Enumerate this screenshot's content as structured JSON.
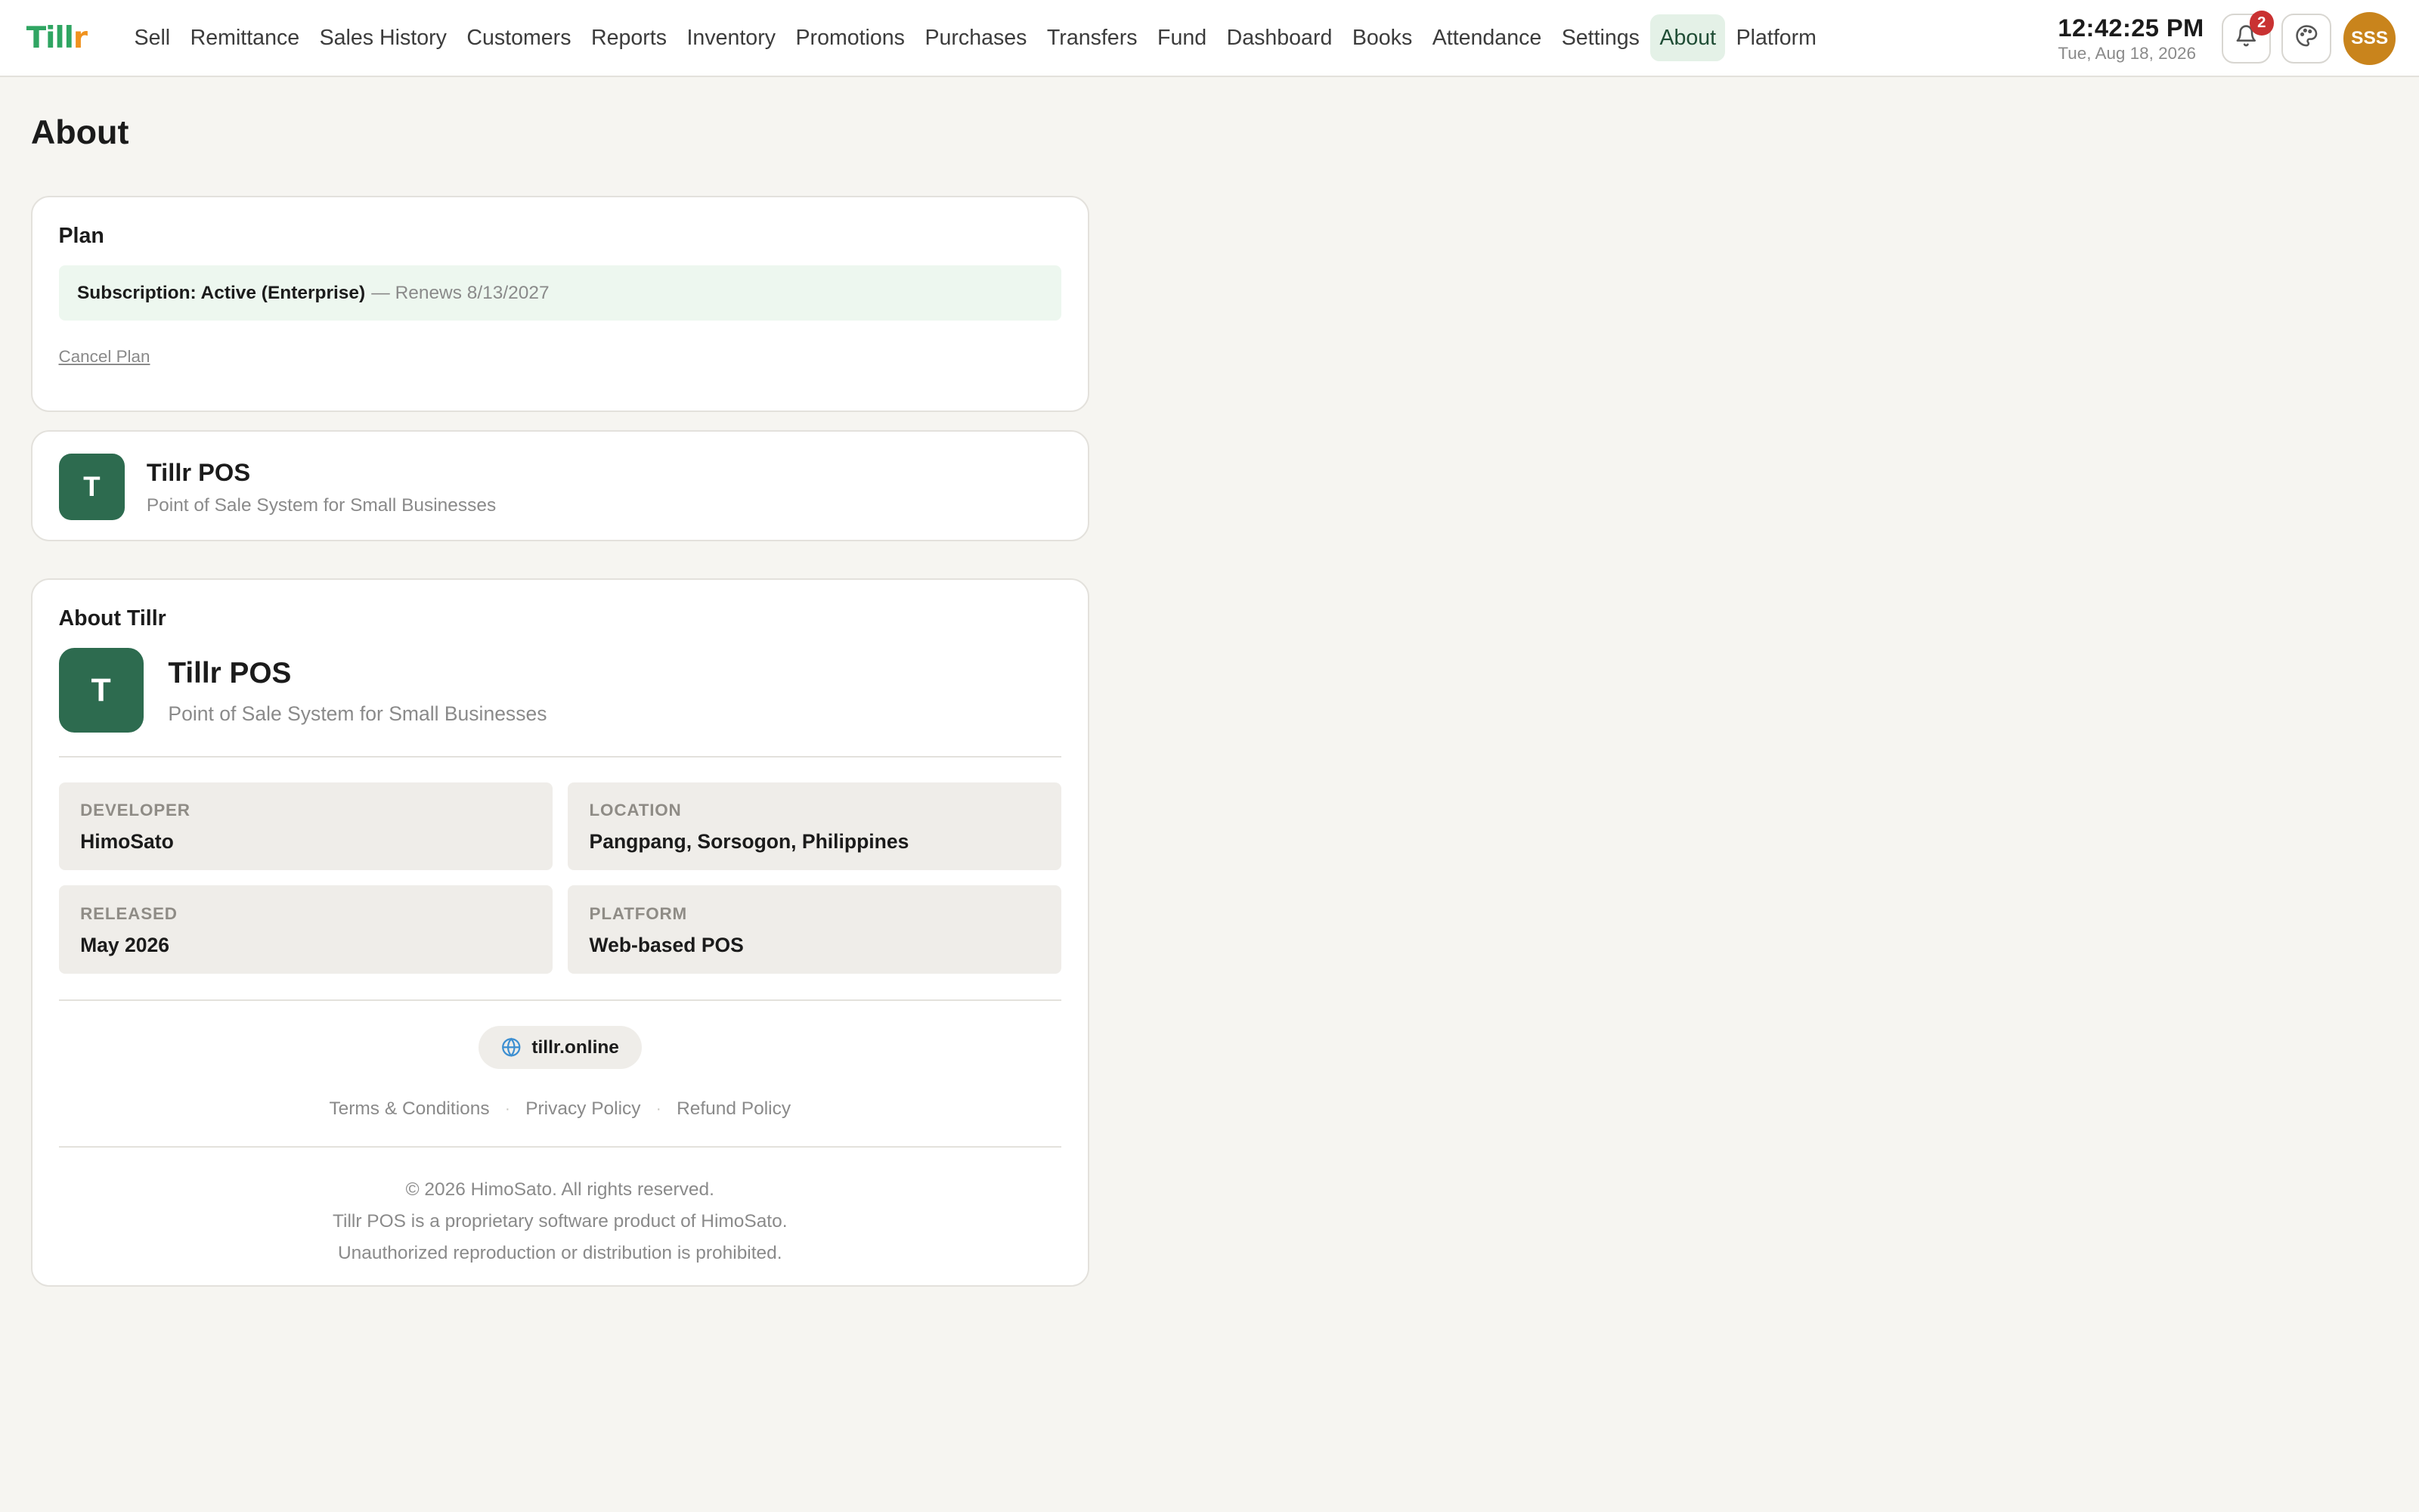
{
  "brand": {
    "logo_text_green": "Till",
    "logo_text_orange": "r"
  },
  "nav": {
    "items": [
      {
        "label": "Sell"
      },
      {
        "label": "Remittance"
      },
      {
        "label": "Sales History"
      },
      {
        "label": "Customers"
      },
      {
        "label": "Reports"
      },
      {
        "label": "Inventory"
      },
      {
        "label": "Promotions"
      },
      {
        "label": "Purchases"
      },
      {
        "label": "Transfers"
      },
      {
        "label": "Fund"
      },
      {
        "label": "Dashboard"
      },
      {
        "label": "Books"
      },
      {
        "label": "Attendance"
      },
      {
        "label": "Settings"
      },
      {
        "label": "About",
        "active": true
      },
      {
        "label": "Platform"
      }
    ]
  },
  "header": {
    "time": "12:42:25 PM",
    "date": "Tue, Aug 18, 2026",
    "notification_count": "2",
    "notification_icon": "bell-icon",
    "theme_icon": "palette-icon",
    "avatar_initials": "SSS"
  },
  "page": {
    "title": "About"
  },
  "plan": {
    "title": "Plan",
    "subscription": "Subscription: Active (Enterprise)",
    "renews": "— Renews 8/13/2027",
    "cancel_label": "Cancel Plan"
  },
  "app_card": {
    "logo_letter": "T",
    "name": "Tillr POS",
    "tagline": "Point of Sale System for Small Businesses"
  },
  "about": {
    "title": "About Tillr",
    "logo_letter": "T",
    "name": "Tillr POS",
    "tagline": "Point of Sale System for Small Businesses",
    "info": [
      {
        "label": "DEVELOPER",
        "value": "HimoSato"
      },
      {
        "label": "LOCATION",
        "value": "Pangpang, Sorsogon, Philippines"
      },
      {
        "label": "RELEASED",
        "value": "May 2026"
      },
      {
        "label": "PLATFORM",
        "value": "Web-based POS"
      }
    ],
    "website_icon": "globe-icon",
    "website": "tillr.online",
    "links": [
      "Terms & Conditions",
      "Privacy Policy",
      "Refund Policy"
    ],
    "link_separator": "·",
    "legal": [
      "© 2026 HimoSato. All rights reserved.",
      "Tillr POS is a proprietary software product of HimoSato.",
      "Unauthorized reproduction or distribution is prohibited."
    ]
  },
  "colors": {
    "brand_green": "#2fa562",
    "brand_orange": "#f0921e",
    "app_logo_bg": "#2d6b4f",
    "avatar_bg": "#c9841c",
    "badge_red": "#c93232",
    "active_nav_bg": "#e4f1e7",
    "plan_banner_bg": "#edf7ef"
  }
}
